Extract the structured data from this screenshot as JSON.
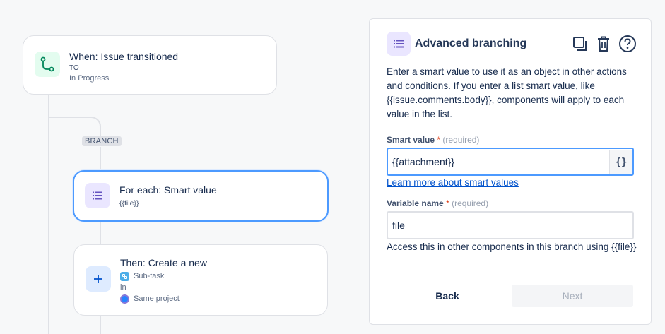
{
  "canvas": {
    "trigger": {
      "title": "When: Issue transitioned",
      "to_label": "TO",
      "status": "In Progress",
      "icon": "branch-path-icon"
    },
    "branch_label": "BRANCH",
    "branch_node": {
      "title": "For each: Smart value",
      "value": "{{file}}",
      "icon": "list-icon"
    },
    "action_node": {
      "title": "Then: Create a new",
      "issue_type": "Sub-task",
      "in_label": "in",
      "project": "Same project",
      "icon": "plus-icon"
    }
  },
  "panel": {
    "title": "Advanced branching",
    "description": "Enter a smart value to use it as an object in other actions and conditions. If you enter a list smart value, like {{issue.comments.body}}, components will apply to each value in the list.",
    "smart_value": {
      "label": "Smart value",
      "required_mark": "*",
      "required_hint": "(required)",
      "value": "{{attachment}}",
      "brace_button": "{}"
    },
    "learn_more": "Learn more about smart values",
    "variable_name": {
      "label": "Variable name",
      "required_mark": "*",
      "required_hint": "(required)",
      "value": "file"
    },
    "help_text": "Access this in other components in this branch using {{file}}",
    "back_label": "Back",
    "next_label": "Next"
  },
  "colors": {
    "accent": "#4c9aff",
    "link": "#0052cc",
    "trigger_bg": "#e3fcef",
    "branch_bg": "#eae6ff",
    "action_bg": "#deebff"
  }
}
